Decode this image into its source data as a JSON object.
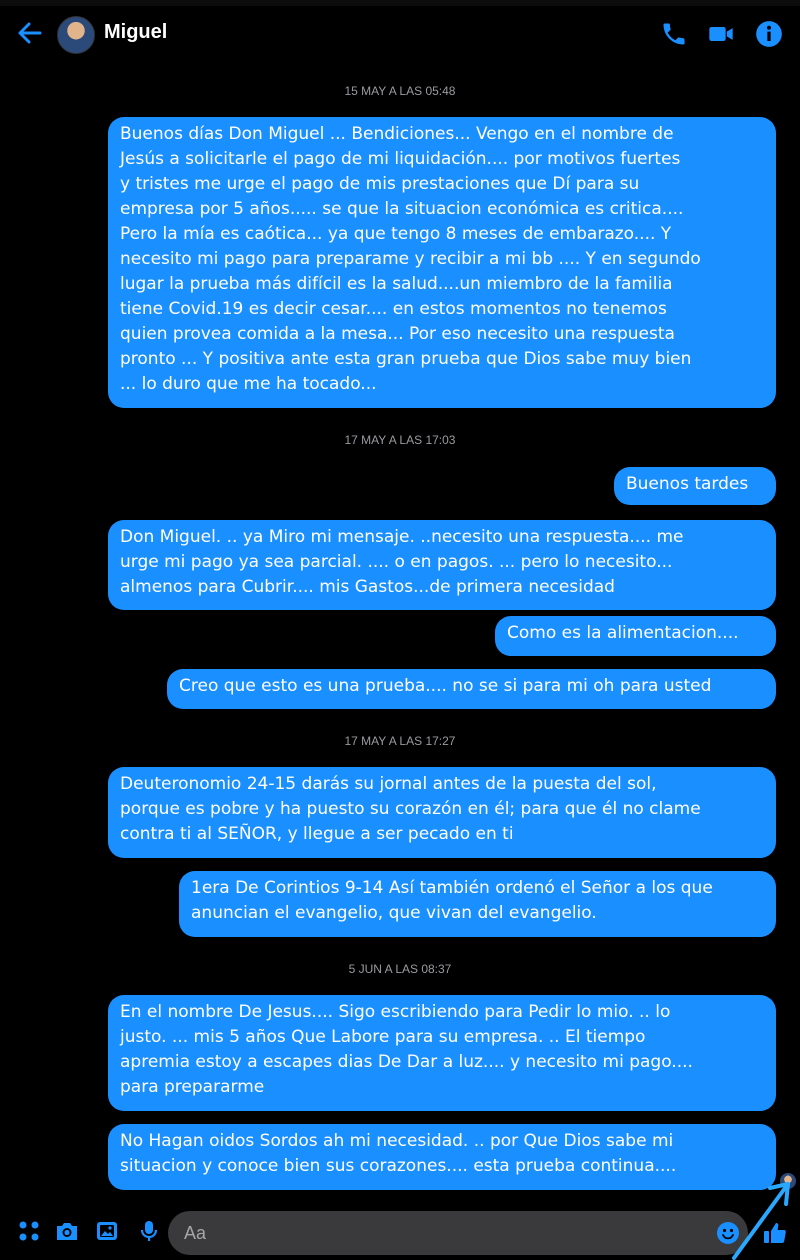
{
  "header": {
    "contact_name": "Miguel"
  },
  "icons": {
    "back": "arrow-left-icon",
    "call": "phone-icon",
    "video": "video-camera-icon",
    "info": "info-icon",
    "menu": "four-dots-icon",
    "camera": "camera-icon",
    "gallery": "image-icon",
    "mic": "microphone-icon",
    "emoji": "smiley-icon",
    "like": "thumbs-up-icon"
  },
  "colors": {
    "accent": "#1a8fff",
    "background": "#000000",
    "input_bg": "#3a3a3c",
    "timestamp": "#9a9aa0"
  },
  "timestamps": [
    "15 MAY A LAS 05:48",
    "17 MAY A LAS 17:03",
    "17 MAY A LAS 17:27",
    "5 JUN A LAS 08:37"
  ],
  "messages": [
    {
      "text": "Buenos días Don Miguel ... Bendiciones... Vengo en el nombre de\nJesús a solicitarle el pago de mi liquidación.... por motivos fuertes\ny tristes me urge el pago de mis prestaciones que Dí para su\nempresa por 5 años..... se que la situacion económica es critica....\nPero la mía es caótica... ya que tengo 8 meses de embarazo.... Y\nnecesito mi pago para preparame y recibir a mi bb .... Y en segundo\nlugar la prueba más difícil es la salud....un miembro de la familia\ntiene Covid.19 es decir cesar.... en estos momentos no tenemos\nquien provea comida a la mesa... Por eso necesito una respuesta\npronto ... Y positiva ante esta gran prueba que Dios sabe muy bien\n... lo duro que me ha tocado..."
    },
    {
      "text": "Buenos tardes"
    },
    {
      "text": "Don Miguel. .. ya Miro mi mensaje. ..necesito una respuesta.... me\nurge mi pago ya sea parcial. .... o en pagos. ... pero lo necesito...\nalmenos para Cubrir.... mis Gastos...de primera necesidad"
    },
    {
      "text": "Como es la alimentacion...."
    },
    {
      "text": "Creo que esto es una prueba.... no se si para mi oh para usted"
    },
    {
      "text": "Deuteronomio 24-15   darás su jornal antes de la puesta del sol,\nporque es pobre y ha puesto su corazón en él; para que él no clame\ncontra ti al SEÑOR, y llegue a ser pecado en ti"
    },
    {
      "text": "1era De Corintios 9-14 Así también ordenó el Señor a los que\nanuncian el evangelio, que vivan del evangelio."
    },
    {
      "text": "En el nombre De Jesus.... Sigo escribiendo para Pedir lo mio. .. lo\njusto. ... mis 5 años Que Labore para su empresa. .. El tiempo\napremia estoy a escapes dias De Dar a luz.... y necesito mi pago....\npara prepararme"
    },
    {
      "text": "No Hagan oidos Sordos ah mi necesidad. .. por Que Dios sabe mi\nsituacion y conoce bien sus corazones.... esta prueba continua...."
    }
  ],
  "composer": {
    "placeholder": "Aa"
  }
}
